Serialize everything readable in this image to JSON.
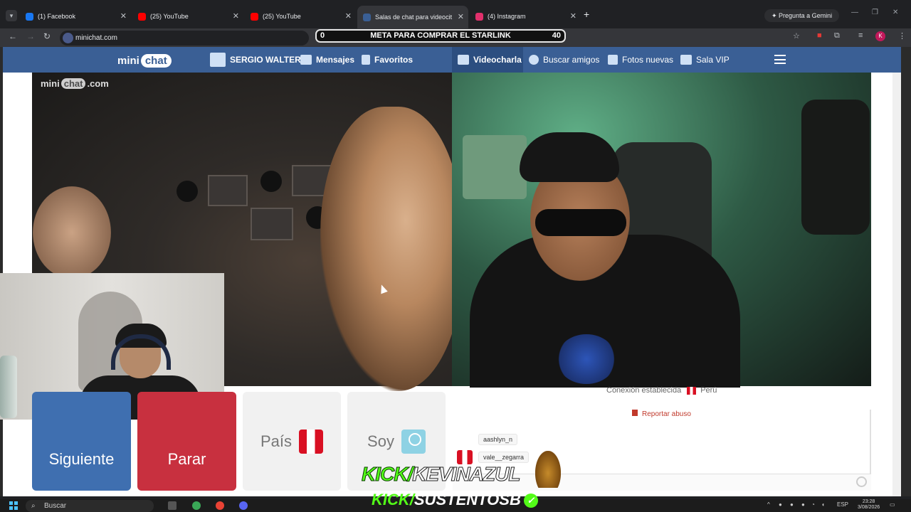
{
  "browser": {
    "tabs": [
      {
        "title": "(1) Facebook",
        "color": "#1877f2"
      },
      {
        "title": "(25) YouTube",
        "color": "#ff0000"
      },
      {
        "title": "(25) YouTube",
        "color": "#ff0000"
      },
      {
        "title": "Salas de chat para videocit",
        "color": "#3a5f95"
      },
      {
        "title": "(4) Instagram",
        "color": "#e1306c"
      }
    ],
    "gemini_label": "Pregunta a Gemini",
    "url": "minichat.com",
    "profile_initial": "K",
    "minimize_icon": "minimize-icon",
    "restore_icon": "restore-icon",
    "close_icon": "close-icon"
  },
  "goal_bar": {
    "start": "0",
    "label": "META PARA COMPRAR EL STARLINK",
    "end": "40"
  },
  "site": {
    "logo_mini": "mini",
    "logo_chat": "chat",
    "nav": {
      "user": "SERGIO WALTER",
      "messages": "Mensajes",
      "favorites": "Favoritos",
      "videochat": "Videocharla",
      "find_friends": "Buscar amigos",
      "new_photos": "Fotos nuevas",
      "vip": "Sala VIP"
    },
    "watermark_mini": "mini",
    "watermark_chat": "chat",
    "watermark_domain": ".com"
  },
  "controls": {
    "next": "Siguiente",
    "stop": "Parar",
    "country": "País",
    "i_am": "Soy"
  },
  "chat": {
    "status": "Conexión establecida",
    "country": "Perú",
    "report": "Reportar abuso",
    "users": [
      "aashlyn_n",
      "vale__zegarra"
    ]
  },
  "overlay": {
    "kick1_green": "KICK/",
    "kick1_white": "KEVINAZUL",
    "kick2_green": "KICK/",
    "kick2_white": "SUSTENTOSB",
    "check": "✓"
  },
  "taskbar": {
    "search": "Buscar",
    "lang": "ESP",
    "time": "23:28",
    "date": "3/08/2026"
  },
  "colors": {
    "brand": "#3a5f95",
    "next_button": "#3f6fb0",
    "stop_button": "#c8303f",
    "kick_green": "#53fc18"
  }
}
